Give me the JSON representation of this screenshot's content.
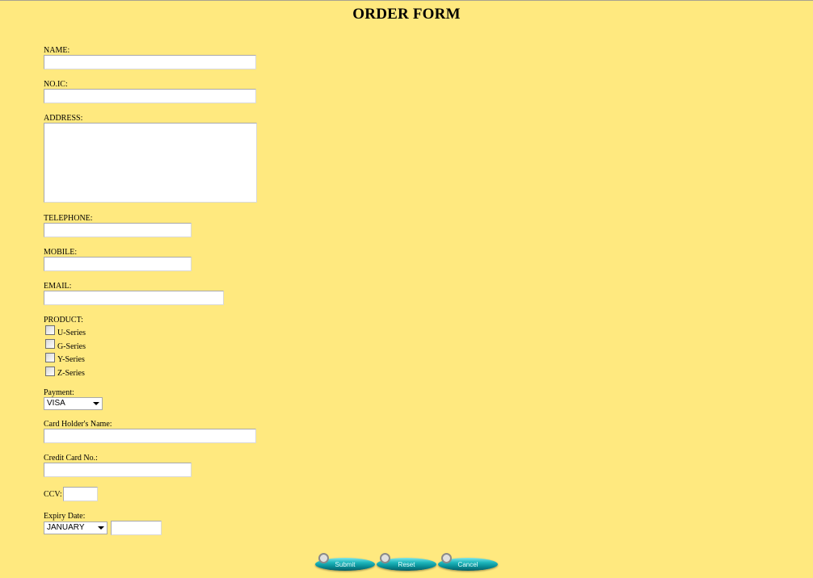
{
  "form": {
    "title": "ORDER FORM",
    "name_label": "NAME:",
    "ic_label": "NO.IC:",
    "address_label": "ADDRESS:",
    "telephone_label": "TELEPHONE:",
    "mobile_label": "MOBILE:",
    "email_label": "EMAIL:",
    "product_label": "PRODUCT:",
    "products": [
      "U-Series",
      "G-Series",
      "Y-Series",
      "Z-Series"
    ],
    "payment_label": "Payment:",
    "payment_value": "VISA",
    "card_holder_label": "Card Holder's Name:",
    "credit_card_label": "Credit Card No.:",
    "ccv_label": "CCV:",
    "expiry_label": "Expiry Date:",
    "expiry_month_value": "JANUARY"
  },
  "buttons": {
    "submit": "Submit",
    "reset": "Reset",
    "cancel": "Cancel"
  },
  "colors": {
    "background": "#FFE97F",
    "button_accent": "#078a93"
  }
}
